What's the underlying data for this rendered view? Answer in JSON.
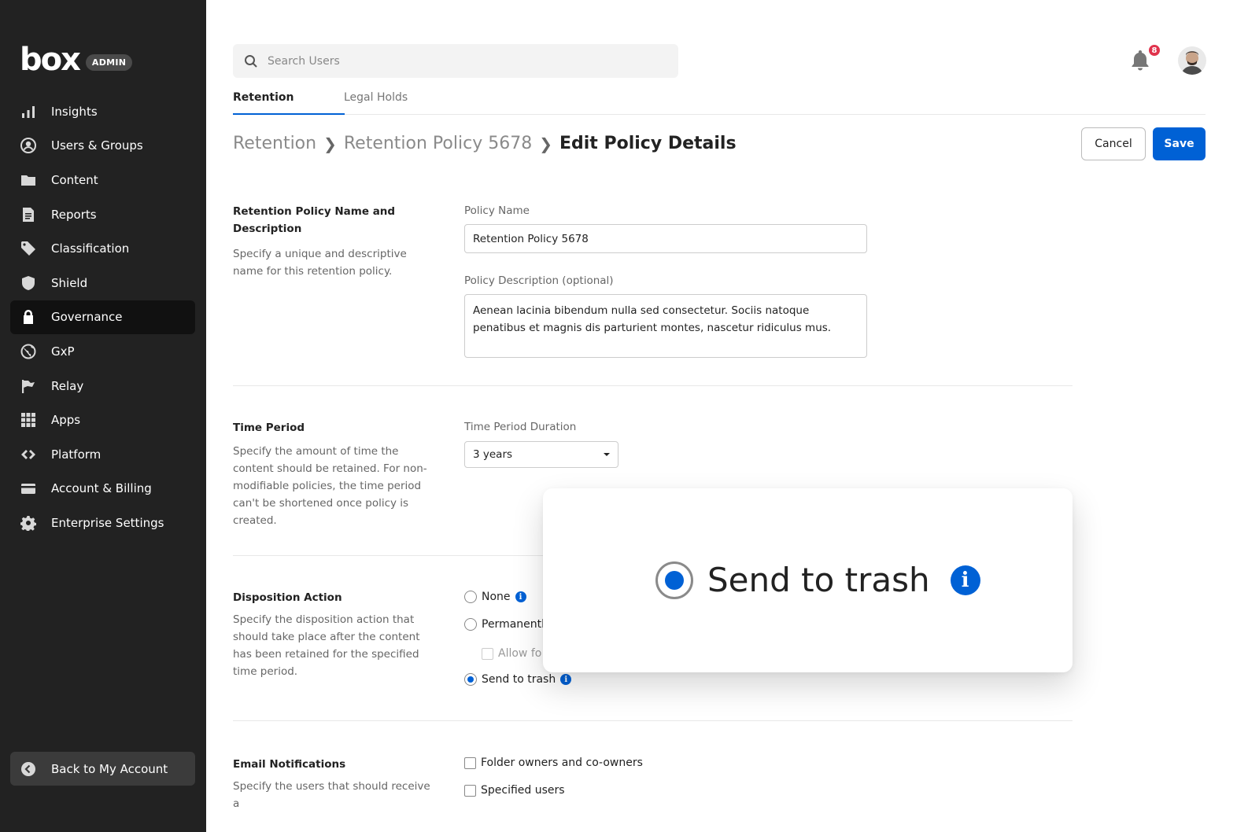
{
  "app": {
    "logo_text": "box",
    "badge": "ADMIN"
  },
  "sidebar": {
    "items": [
      {
        "label": "Insights",
        "icon": "bar-chart-icon"
      },
      {
        "label": "Users & Groups",
        "icon": "user-circle-icon"
      },
      {
        "label": "Content",
        "icon": "folder-icon"
      },
      {
        "label": "Reports",
        "icon": "report-icon"
      },
      {
        "label": "Classification",
        "icon": "tag-icon"
      },
      {
        "label": "Shield",
        "icon": "shield-icon"
      },
      {
        "label": "Governance",
        "icon": "lock-icon",
        "active": true
      },
      {
        "label": "GxP",
        "icon": "globe-icon"
      },
      {
        "label": "Relay",
        "icon": "flag-icon"
      },
      {
        "label": "Apps",
        "icon": "grid-icon"
      },
      {
        "label": "Platform",
        "icon": "code-icon"
      },
      {
        "label": "Account & Billing",
        "icon": "credit-card-icon"
      },
      {
        "label": "Enterprise Settings",
        "icon": "gear-icon"
      }
    ],
    "back_label": "Back to My Account"
  },
  "header": {
    "search_placeholder": "Search Users",
    "notification_count": "8"
  },
  "tabs": [
    {
      "label": "Retention",
      "active": true
    },
    {
      "label": "Legal Holds",
      "active": false
    }
  ],
  "breadcrumb": {
    "items": [
      "Retention",
      "Retention Policy 5678"
    ],
    "current": "Edit Policy Details"
  },
  "actions": {
    "cancel": "Cancel",
    "save": "Save"
  },
  "sections": {
    "name": {
      "title": "Retention Policy Name and Description",
      "description": "Specify a unique and descriptive name for this retention policy.",
      "policy_name_label": "Policy Name",
      "policy_name_value": "Retention Policy 5678",
      "policy_desc_label": "Policy Description (optional)",
      "policy_desc_value": "Aenean lacinia bibendum nulla sed consectetur. Sociis natoque penatibus et magnis dis parturient montes, nascetur ridiculus mus."
    },
    "time": {
      "title": "Time Period",
      "description": "Specify the amount of time the content should be retained. For non-modifiable policies, the time period can't be shortened once policy is created.",
      "duration_label": "Time Period Duration",
      "duration_value": "3 years"
    },
    "disposition": {
      "title": "Disposition Action",
      "description": "Specify the disposition action that should take place after the content has been retained for the specified time period.",
      "options": {
        "none": "None",
        "permanently": "Permanently",
        "allow": "Allow fo",
        "trash": "Send to trash"
      },
      "selected": "trash"
    },
    "email": {
      "title": "Email Notifications",
      "description": "Specify the users that should receive a",
      "options": {
        "owners": "Folder owners and co-owners",
        "specified": "Specified users"
      }
    }
  },
  "callout": {
    "label": "Send to trash",
    "info_glyph": "i"
  },
  "colors": {
    "sidebar_bg": "#222222",
    "accent": "#0061d5",
    "badge_red": "#e0334c"
  }
}
